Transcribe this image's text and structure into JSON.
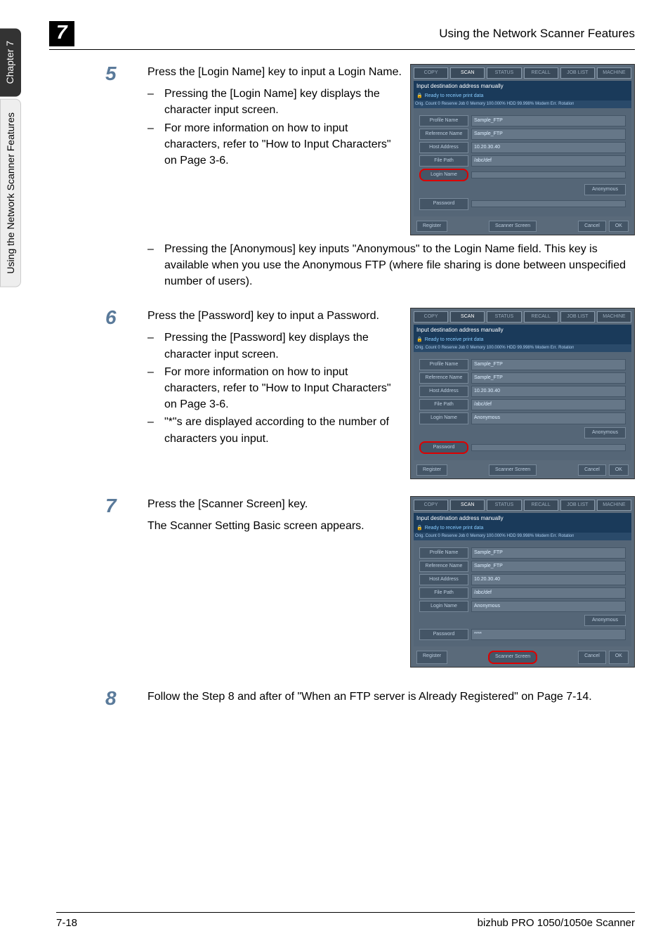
{
  "sidebar": {
    "chapter_tab": "Chapter 7",
    "feature_tab": "Using the Network Scanner Features"
  },
  "header": {
    "chapter_number": "7",
    "title": "Using the Network Scanner Features"
  },
  "steps": {
    "s5": {
      "num": "5",
      "intro": "Press the [Login Name] key to input a Login Name.",
      "b1": "Pressing the [Login Name] key displays the character input screen.",
      "b2": "For more information on how to input characters, refer to \"How to Input Characters\" on Page 3-6.",
      "b3": "Pressing the [Anonymous] key inputs \"Anonymous\" to the Login Name field. This key is available when you use the Anonymous FTP (where file sharing is done between unspecified number of users)."
    },
    "s6": {
      "num": "6",
      "intro": "Press the [Password] key to input a Password.",
      "b1": "Pressing the [Password] key displays the character input screen.",
      "b2": "For more information on how to input characters, refer to \"How to Input Characters\" on Page 3-6.",
      "b3": "\"*\"s are displayed according to the number of characters you input."
    },
    "s7": {
      "num": "7",
      "intro": "Press the [Scanner Screen] key.",
      "p2": "The Scanner Setting Basic screen appears."
    },
    "s8": {
      "num": "8",
      "intro": "Follow the Step 8 and after of \"When an FTP server is Already Registered\" on Page 7-14."
    }
  },
  "screenshot_common": {
    "tabs": [
      "COPY",
      "SCAN",
      "STATUS",
      "RECALL",
      "JOB LIST",
      "MACHINE"
    ],
    "titlebar": "Input destination address manually",
    "status_ready": "Ready to receive print data",
    "statbar": {
      "orig": "Orig. Count   0",
      "reserve": "Reserve Job   0",
      "memory": "Memory  100.000%",
      "hdd": "HDD     99.998%",
      "modem": "Modem Err.",
      "rotation": "Rotation"
    },
    "labels": {
      "profile": "Profile Name",
      "reference": "Reference Name",
      "host": "Host Address",
      "filepath": "File Path",
      "login": "Login Name",
      "password": "Password",
      "anonymous": "Anonymous",
      "register": "Register",
      "scanner_screen": "Scanner Screen",
      "cancel": "Cancel",
      "ok": "OK"
    },
    "values": {
      "profile": "Sample_FTP",
      "reference": "Sample_FTP",
      "host": "10.20.30.40",
      "filepath": "/abc/def",
      "login_anon": "Anonymous",
      "pwd_stars": "****"
    }
  },
  "footer": {
    "page": "7-18",
    "product": "bizhub PRO 1050/1050e Scanner"
  }
}
